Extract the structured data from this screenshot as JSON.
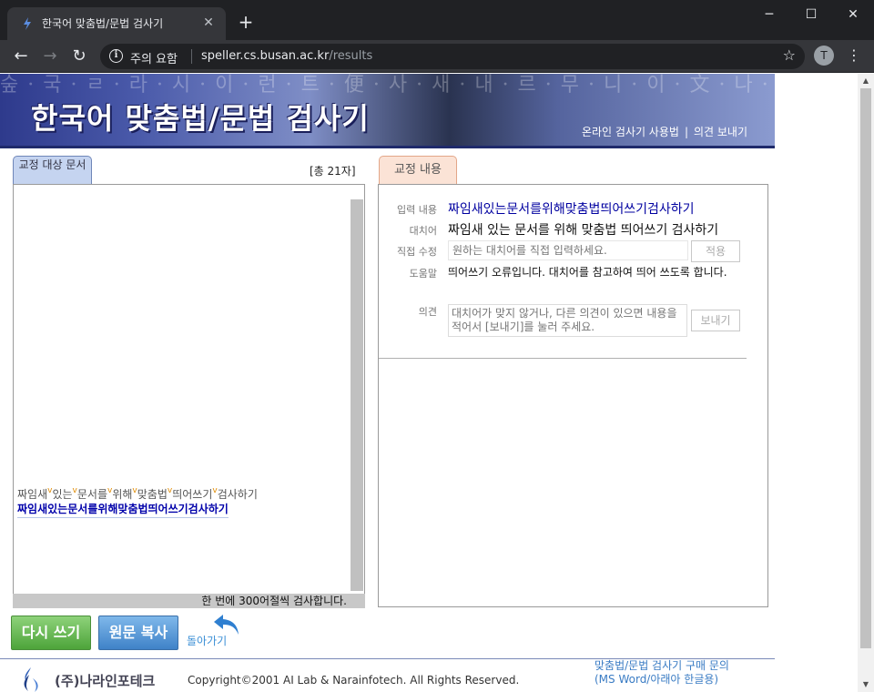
{
  "browser": {
    "tab_title": "한국어 맞춤법/문법 검사기",
    "tab_close": "✕",
    "new_tab": "+",
    "window_controls": {
      "minimize": "─",
      "maximize": "☐",
      "close": "✕"
    },
    "nav": {
      "back": "←",
      "forward": "→",
      "reload": "↻"
    },
    "security_icon": "i",
    "security_label": "주의 요함",
    "url_host": "speller.cs.busan.ac.kr",
    "url_path": "/results",
    "bookmark_icon": "☆",
    "profile_initial": "T",
    "menu_icon": "⋮"
  },
  "banner": {
    "background_text": "숲·국·ㄹ·라·시·이·런·트·便·사·새·내·르·무·니·이·文·나·어·하·입·의·화·장·가·나",
    "title": "한국어 맞춤법/문법 검사기",
    "links": {
      "usage": "온라인 검사기 사용법",
      "separator": "|",
      "feedback": "의견 보내기"
    }
  },
  "left_panel": {
    "tab_label": "교정 대상 문서",
    "char_count": "[총 21자]",
    "original_segments": [
      "짜임새",
      "있는",
      "문서를",
      "위해",
      "맞춤법",
      "띄어쓰기",
      "검사하기"
    ],
    "corrected_text": "짜임새있는문서를위해맞춤법띄어쓰기검사하기",
    "status": "한 번에 300어절씩 검사합니다.",
    "scroll_down": "▼"
  },
  "right_panel": {
    "tab_label": "교정 내용",
    "input_label": "입력 내용",
    "input_value": "짜임새있는문서를위해맞춤법띄어쓰기검사하기",
    "suggestion_label": "대치어",
    "suggestion_value": "짜임새 있는 문서를 위해 맞춤법 띄어쓰기 검사하기",
    "direct_label": "직접 수정",
    "direct_placeholder": "원하는 대치어를 직접 입력하세요.",
    "apply_button": "적용",
    "help_label": "도움말",
    "help_text": "띄어쓰기 오류입니다. 대치어를 참고하여 띄어 쓰도록 합니다.",
    "opinion_label": "의견",
    "opinion_placeholder": "대치어가 맞지 않거나, 다른 의견이 있으면 내용을 적어서 [보내기]를 눌러 주세요.",
    "send_button": "보내기"
  },
  "actions": {
    "rewrite": "다시 쓰기",
    "copy_original": "원문 복사",
    "back": "돌아가기"
  },
  "footer": {
    "company": "(주)나라인포테크",
    "copyright": "Copyright©2001 AI Lab & Narainfotech. All Rights Reserved.",
    "buy_line1": "맞춤법/문법 검사기 구매 문의",
    "buy_line2": "(MS Word/아래아 한글용)"
  },
  "colors": {
    "banner_dark": "#1f2a6b",
    "input_text": "#0000a0",
    "marker": "#e08a00",
    "rewrite_green": "#4da43a",
    "copy_blue": "#3f82c8",
    "link_blue": "#3a7cc4"
  }
}
